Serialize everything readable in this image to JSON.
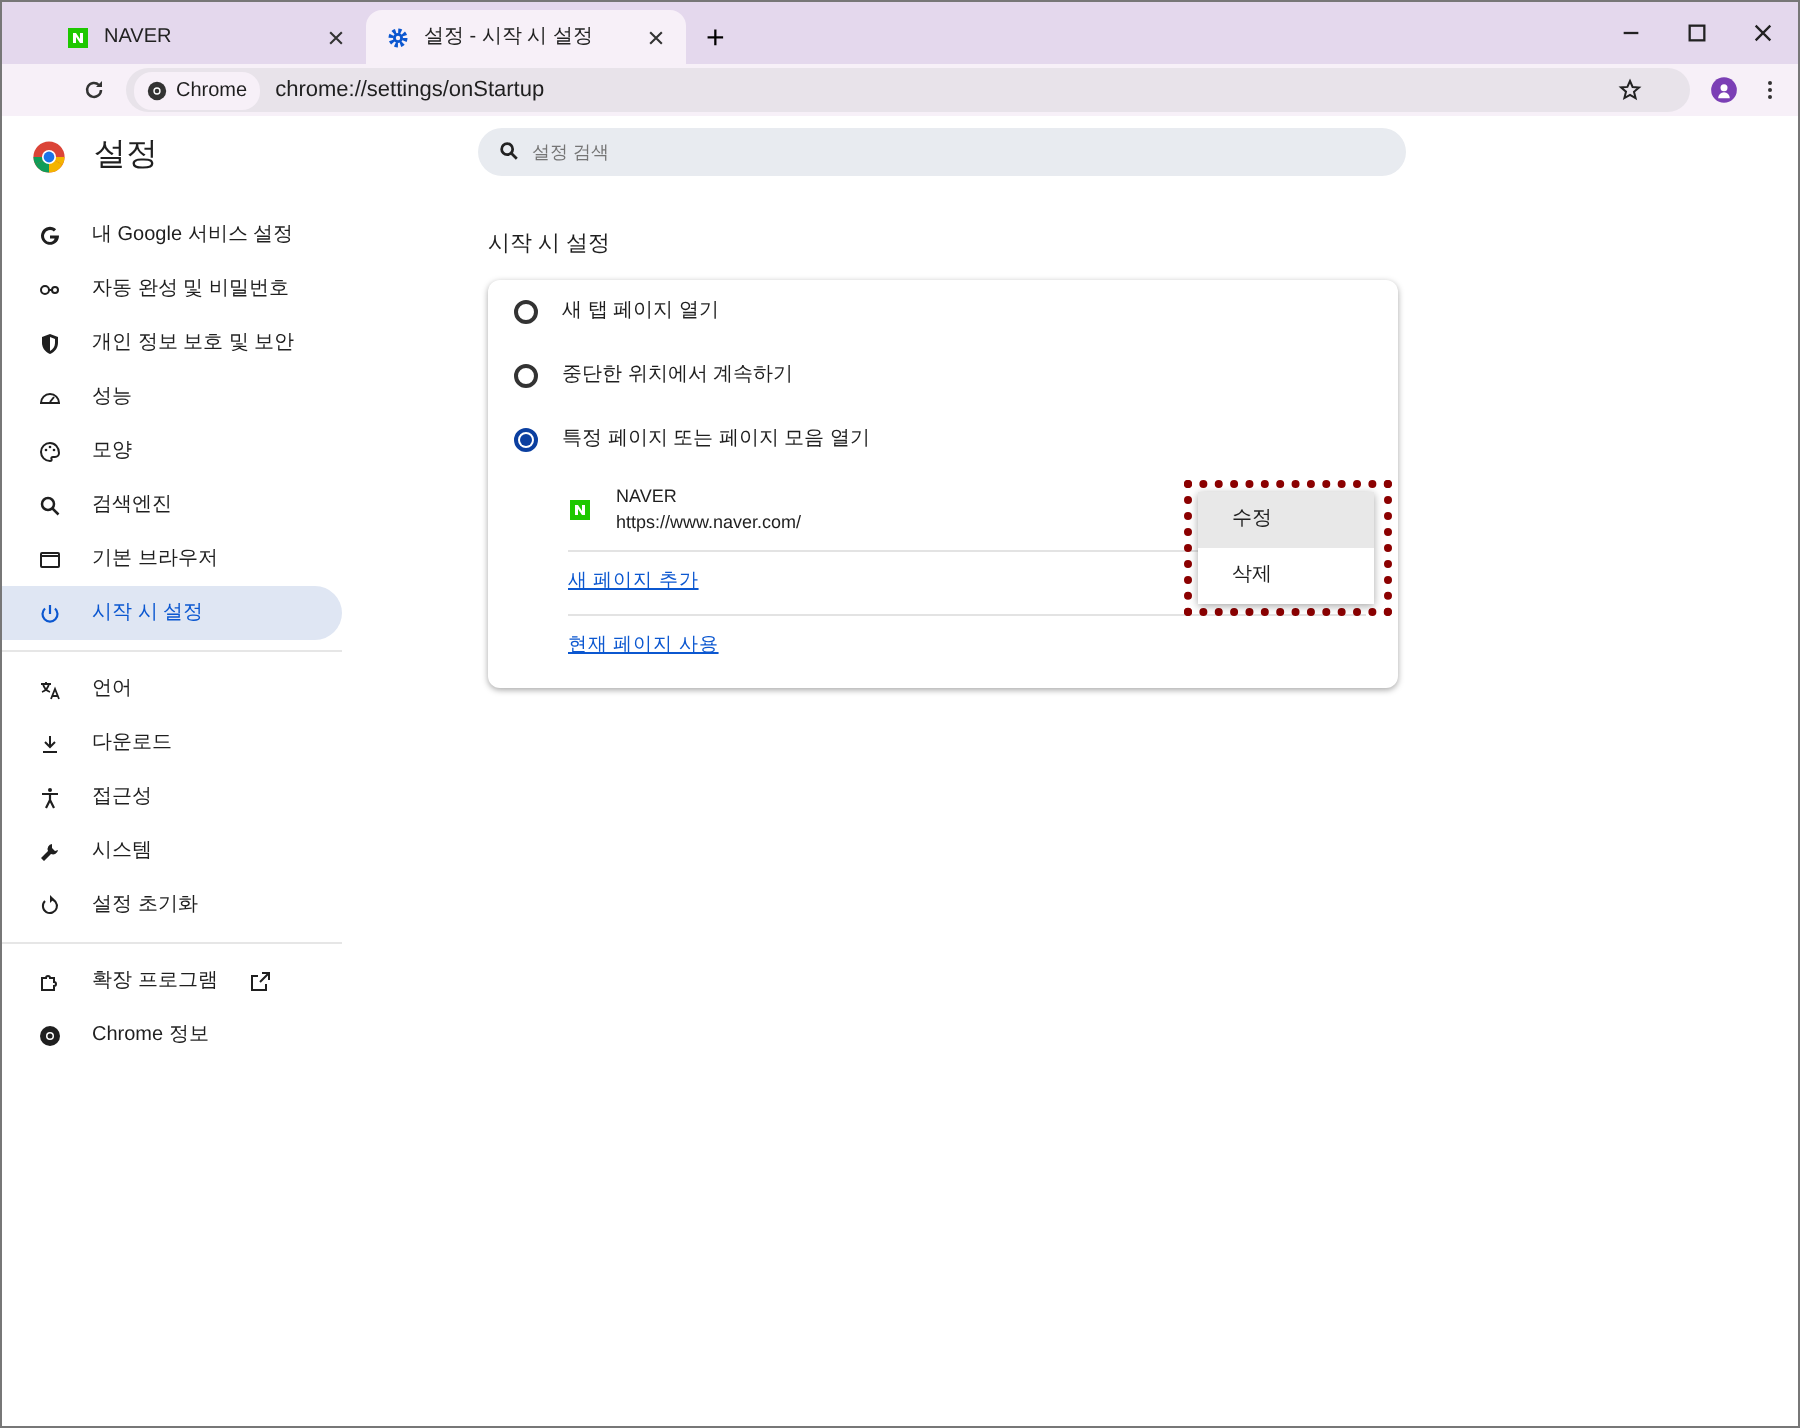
{
  "tabs": [
    {
      "title": "NAVER",
      "selected": false
    },
    {
      "title": "설정 - 시작 시 설정",
      "selected": true
    }
  ],
  "new_tab_button": "+",
  "address_bar": {
    "chip": "Chrome",
    "url": "chrome://settings/onStartup"
  },
  "sidebar": {
    "title": "설정",
    "groups": [
      [
        {
          "label": "내 Google 서비스 설정",
          "selected": false
        },
        {
          "label": "자동 완성 및 비밀번호",
          "selected": false
        },
        {
          "label": "개인 정보 보호 및 보안",
          "selected": false
        },
        {
          "label": "성능",
          "selected": false
        },
        {
          "label": "모양",
          "selected": false
        },
        {
          "label": "검색엔진",
          "selected": false
        },
        {
          "label": "기본 브라우저",
          "selected": false
        },
        {
          "label": "시작 시 설정",
          "selected": true
        }
      ],
      [
        {
          "label": "언어",
          "selected": false
        },
        {
          "label": "다운로드",
          "selected": false
        },
        {
          "label": "접근성",
          "selected": false
        },
        {
          "label": "시스템",
          "selected": false
        },
        {
          "label": "설정 초기화",
          "selected": false
        }
      ],
      [
        {
          "label": "확장 프로그램",
          "selected": false,
          "external": true
        },
        {
          "label": "Chrome 정보",
          "selected": false
        }
      ]
    ]
  },
  "search": {
    "placeholder": "설정 검색"
  },
  "section_title": "시작 시 설정",
  "startup_options": [
    {
      "label": "새 탭 페이지 열기",
      "selected": false
    },
    {
      "label": "중단한 위치에서 계속하기",
      "selected": false
    },
    {
      "label": "특정 페이지 또는 페이지 모음 열기",
      "selected": true
    }
  ],
  "pages": [
    {
      "name": "NAVER",
      "url": "https://www.naver.com/"
    }
  ],
  "links": [
    "새 페이지 추가",
    "현재 페이지 사용"
  ],
  "context_menu": {
    "highlight_frame": true,
    "items": [
      {
        "label": "수정",
        "hovered": true
      },
      {
        "label": "삭제",
        "hovered": false
      }
    ]
  }
}
